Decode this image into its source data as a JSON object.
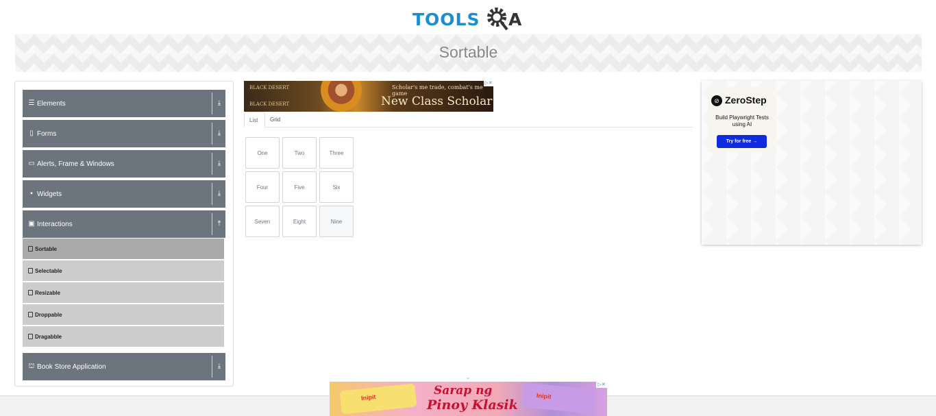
{
  "header": {
    "logo_text_left": "TOOLS",
    "logo_text_right": "A",
    "page_title": "Sortable"
  },
  "sidebar": {
    "groups": [
      {
        "label": "Elements",
        "icon": "list-icon",
        "arrow": "download-arrow-icon"
      },
      {
        "label": "Forms",
        "icon": "form-icon",
        "arrow": "download-arrow-icon"
      },
      {
        "label": "Alerts, Frame & Windows",
        "icon": "window-icon",
        "arrow": "download-arrow-icon"
      },
      {
        "label": "Widgets",
        "icon": "widgets-icon",
        "arrow": "download-arrow-icon"
      },
      {
        "label": "Interactions",
        "icon": "interactions-icon",
        "arrow": "upload-arrow-icon"
      },
      {
        "label": "Book Store Application",
        "icon": "bookstore-icon",
        "arrow": "download-arrow-icon"
      }
    ],
    "interaction_items": [
      {
        "label": "Sortable",
        "active": true
      },
      {
        "label": "Selectable",
        "active": false
      },
      {
        "label": "Resizable",
        "active": false
      },
      {
        "label": "Droppable",
        "active": false
      },
      {
        "label": "Dragabble",
        "active": false
      }
    ]
  },
  "ad_top": {
    "brand_line1": "BLACK DESERT",
    "brand_line2": "BLACK DESERT",
    "tagline": "Scholar's me trade, combat's me game",
    "headline": "New Class Scholar"
  },
  "tabs": [
    {
      "label": "List",
      "active": true
    },
    {
      "label": "Grid",
      "active": false
    }
  ],
  "sortable_list": [
    "One",
    "Two",
    "Three",
    "Four",
    "Five",
    "Six",
    "Seven",
    "Eight",
    "Nine"
  ],
  "ad_right": {
    "brand": "ZeroStep",
    "tagline": "Build Playwright Tests using AI",
    "button": "Try for free →"
  },
  "ad_bottom": {
    "brand_left": "Inipit",
    "brand_right": "Inipit",
    "headline_line1": "Sarap ng",
    "headline_line2": "Pinoy Klasik"
  },
  "colors": {
    "sidebar_header": "#6c757d",
    "sidebar_item": "#cccccc",
    "sidebar_item_active": "#aaaaaa",
    "active_tab": "#007bff",
    "zerostep_button": "#0d2be0",
    "logo_blue": "#1a8fd0"
  }
}
